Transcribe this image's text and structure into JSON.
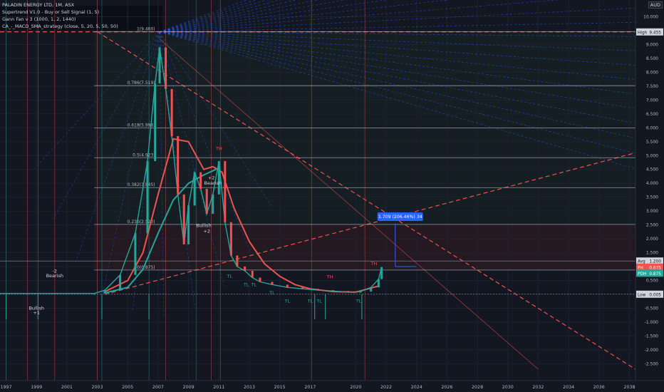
{
  "header": {
    "symbol": "PALADIN ENERGY LTD, 1M, ASX",
    "indicators": [
      "Supertrend V1.0 - Buy or Sell Signal (1, 5)",
      "Gann Fan v 3 (1000, 1, 2, 1440)",
      "CA_-_MACD_SMA_strategy (close, 5, 20, 5, 50, 50)"
    ],
    "currency": "AUD"
  },
  "colors": {
    "background": "#131722",
    "bull": "#26a69a",
    "bear": "#ef5350",
    "fan": "#2962ff",
    "grid": "#1e2230"
  },
  "chart_data": {
    "type": "line",
    "title": "PALADIN ENERGY LTD, 1M, ASX",
    "x_ticks": [
      "1997",
      "1999",
      "2001",
      "2003",
      "2005",
      "2007",
      "2009",
      "2011",
      "2013",
      "2015",
      "2017",
      "2020",
      "2022",
      "2024",
      "2026",
      "2028",
      "2030",
      "2032",
      "2034",
      "2036",
      "2038"
    ],
    "y_ticks": [
      "10.000",
      "9.500",
      "9.000",
      "8.500",
      "8.000",
      "7.500",
      "7.000",
      "6.500",
      "6.000",
      "5.500",
      "5.000",
      "4.500",
      "4.000",
      "3.500",
      "3.000",
      "2.500",
      "2.000",
      "1.500",
      "1.000",
      "0.500",
      "0.000",
      "-0.500",
      "-1.000",
      "-1.500",
      "-2.000",
      "-2.500"
    ],
    "ylim": [
      -2.8,
      10.4
    ],
    "price_series": {
      "name": "",
      "x": [
        1996.5,
        2002.8,
        2003.5,
        2004.5,
        2005.5,
        2006.3,
        2006.8,
        2007.1,
        2007.5,
        2007.9,
        2008.3,
        2008.7,
        2009.0,
        2009.4,
        2009.8,
        2010.2,
        2010.6,
        2011.0,
        2011.4,
        2011.8,
        2012.2,
        2012.7,
        2013.2,
        2013.7,
        2014.5,
        2015.5,
        2016.5,
        2017.5,
        2018.5,
        2019.5,
        2020.3,
        2021.0,
        2021.5,
        2021.7
      ],
      "y": [
        0.03,
        0.03,
        0.15,
        0.7,
        2.2,
        4.8,
        7.6,
        8.9,
        7.4,
        5.7,
        3.6,
        1.8,
        3.2,
        4.4,
        3.8,
        2.9,
        3.6,
        4.8,
        2.6,
        1.4,
        1.0,
        0.85,
        0.6,
        0.45,
        0.35,
        0.25,
        0.2,
        0.15,
        0.12,
        0.08,
        0.1,
        0.25,
        0.55,
        0.98
      ]
    },
    "ma_series": [
      {
        "name": "",
        "color": "#ef5350",
        "x": [
          2003.5,
          2005.0,
          2006.0,
          2007.0,
          2008.0,
          2009.0,
          2010.0,
          2010.6,
          2011.2,
          2012.0,
          2013.0,
          2014.0,
          2015.0,
          2016.0,
          2017.0,
          2018.5,
          2020.0,
          2021.5
        ],
        "y": [
          0.1,
          0.5,
          1.5,
          3.6,
          5.6,
          5.5,
          4.5,
          4.6,
          4.4,
          3.1,
          1.9,
          1.1,
          0.65,
          0.35,
          0.2,
          0.1,
          0.08,
          0.3
        ]
      },
      {
        "name": "",
        "color": "#26a69a",
        "x": [
          2003.5,
          2005.0,
          2006.0,
          2007.0,
          2008.0,
          2009.0,
          2010.0,
          2010.8
        ],
        "y": [
          0.05,
          0.25,
          0.9,
          2.2,
          3.4,
          4.0,
          4.3,
          4.5
        ]
      }
    ],
    "fib_levels": [
      {
        "label": "1(9.460)",
        "value": 9.46
      },
      {
        "label": "0.786(7.519)",
        "value": 7.519
      },
      {
        "label": "0.618(5.998)",
        "value": 5.998
      },
      {
        "label": "0.5(4.923)",
        "value": 4.923
      },
      {
        "label": "0.382(3.845)",
        "value": 3.845
      },
      {
        "label": "0.236(2.520)",
        "value": 2.52
      },
      {
        "label": "0(0.875)",
        "value": 0.875
      }
    ],
    "annotations": [
      {
        "text": "-2",
        "x": 2000.2,
        "y": 0.78,
        "color": "#d1d4dc"
      },
      {
        "text": "Bearish",
        "x": 2000.2,
        "y": 0.62,
        "color": "#d1d4dc"
      },
      {
        "text": "Bullish",
        "x": 1999.0,
        "y": -0.55,
        "color": "#d1d4dc"
      },
      {
        "text": "+1",
        "x": 1999.0,
        "y": -0.72,
        "color": "#d1d4dc"
      },
      {
        "text": "Bearish",
        "x": 2010.6,
        "y": 3.95,
        "color": "#d1d4dc"
      },
      {
        "text": "+2",
        "x": 2010.5,
        "y": 4.15,
        "color": "#d1d4dc"
      },
      {
        "text": "Bullish",
        "x": 2010.0,
        "y": 2.42,
        "color": "#d1d4dc"
      },
      {
        "text": "+2",
        "x": 2010.2,
        "y": 2.22,
        "color": "#d1d4dc"
      },
      {
        "text": "TH",
        "x": 2011.0,
        "y": 5.2,
        "color": "#ef5350"
      },
      {
        "text": "TH",
        "x": 2018.3,
        "y": 0.58,
        "color": "#ef5350"
      },
      {
        "text": "TH",
        "x": 2021.2,
        "y": 1.05,
        "color": "#ef5350"
      },
      {
        "text": "TL",
        "x": 2011.7,
        "y": 0.6,
        "color": "#26a69a"
      },
      {
        "text": "TL",
        "x": 2012.8,
        "y": 0.3,
        "color": "#26a69a"
      },
      {
        "text": "TL",
        "x": 2013.3,
        "y": 0.3,
        "color": "#26a69a"
      },
      {
        "text": "TL",
        "x": 2014.5,
        "y": 0.0,
        "color": "#26a69a"
      },
      {
        "text": "TL",
        "x": 2015.5,
        "y": -0.3,
        "color": "#26a69a"
      },
      {
        "text": "TL",
        "x": 2017.0,
        "y": -0.3,
        "color": "#26a69a"
      },
      {
        "text": "TL",
        "x": 2017.6,
        "y": -0.3,
        "color": "#26a69a"
      },
      {
        "text": "TL",
        "x": 2020.2,
        "y": -0.3,
        "color": "#26a69a"
      }
    ],
    "measure_label": "1.709 (206.46%) 34",
    "price_tags": [
      {
        "label": "High",
        "value": "9.455",
        "y": 9.455,
        "bg": "#d1d4dc",
        "fg": "#131722"
      },
      {
        "label": "Avg",
        "value": "1.200",
        "y": 1.2,
        "bg": "#d1d4dc",
        "fg": "#131722"
      },
      {
        "label": "PH",
        "value": "0.875",
        "y": 0.98,
        "bg": "#ef5350",
        "fg": "#ffffff"
      },
      {
        "label": "PDH",
        "value": "0.875",
        "y": 0.76,
        "bg": "#26a69a",
        "fg": "#ffffff"
      },
      {
        "label": "Low",
        "value": "0.005",
        "y": 0.005,
        "bg": "#d1d4dc",
        "fg": "#131722"
      }
    ]
  }
}
